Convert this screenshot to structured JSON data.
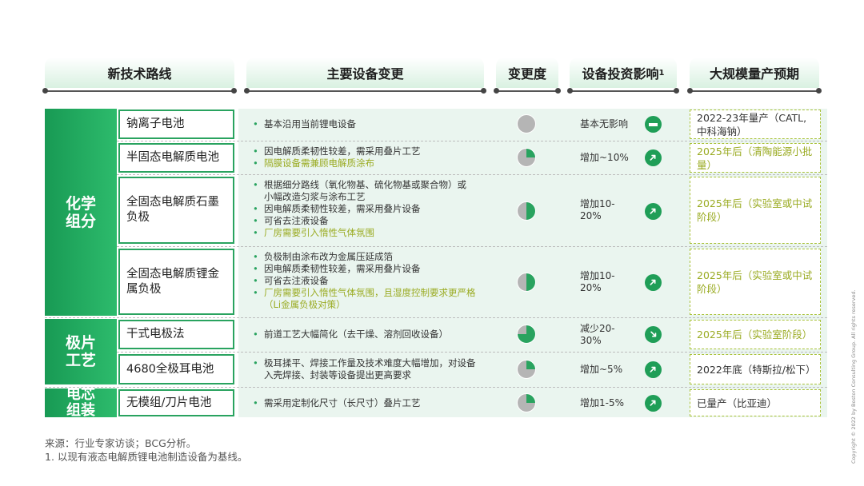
{
  "headers": {
    "route": "新技术路线",
    "equipment": "主要设备变更",
    "degree": "变更度",
    "investment": "设备投资影响",
    "investment_sup": "1",
    "production": "大规模量产预期"
  },
  "categories": {
    "chem_line1": "化学",
    "chem_line2": "组分",
    "pole_line1": "极片",
    "pole_line2": "工艺",
    "pack_line1": "电芯",
    "pack_line2": "组装"
  },
  "rows": [
    {
      "name": "钠离子电池",
      "equipment": [
        {
          "text": "基本沿用当前锂电设备",
          "highlight": false
        }
      ],
      "degree": 0,
      "impact": "基本无影响",
      "impact_icon": "flat-icon",
      "production": "2022-23年量产（CATL,中科海钠）",
      "production_highlight": false
    },
    {
      "name": "半固态电解质电池",
      "equipment": [
        {
          "text": "因电解质柔韧性较差，需采用叠片工艺",
          "highlight": false
        },
        {
          "text": "隔膜设备需兼顾电解质涂布",
          "highlight": true
        }
      ],
      "degree": 0.25,
      "impact": "增加~10%",
      "impact_icon": "arrow-up-right-icon",
      "production": "2025年后（清陶能源小批量）",
      "production_highlight": true
    },
    {
      "name": "全固态电解质石墨负极",
      "equipment": [
        {
          "text": "根据细分路线（氧化物基、硫化物基或聚合物）或小幅改造匀浆与涂布工艺",
          "highlight": false
        },
        {
          "text": "因电解质柔韧性较差，需采用叠片设备",
          "highlight": false
        },
        {
          "text": "可省去注液设备",
          "highlight": false
        },
        {
          "text": "厂房需要引入惰性气体氛围",
          "highlight": true
        }
      ],
      "degree": 0.5,
      "impact": "增加10-20%",
      "impact_icon": "arrow-up-right-icon",
      "production": "2025年后（实验室或中试阶段）",
      "production_highlight": true
    },
    {
      "name": "全固态电解质锂金属负极",
      "equipment": [
        {
          "text": "负极制由涂布改为金属压延成箔",
          "highlight": false
        },
        {
          "text": "因电解质柔韧性较差，需采用叠片设备",
          "highlight": false
        },
        {
          "text": "可省去注液设备",
          "highlight": false
        },
        {
          "text": "厂房需要引入惰性气体氛围，且湿度控制要求更严格（Li金属负极对策）",
          "highlight": true
        }
      ],
      "degree": 0.5,
      "impact": "增加10-20%",
      "impact_icon": "arrow-up-right-icon",
      "production": "2025年后（实验室或中试阶段）",
      "production_highlight": true
    },
    {
      "name": "干式电极法",
      "equipment": [
        {
          "text": "前道工艺大幅简化（去干燥、溶剂回收设备）",
          "highlight": false
        }
      ],
      "degree": 0.75,
      "impact": "减少20-30%",
      "impact_icon": "arrow-down-right-icon",
      "production": "2025年后（实验室阶段）",
      "production_highlight": true
    },
    {
      "name": "4680全极耳电池",
      "equipment": [
        {
          "text": "极耳揉平、焊接工作量及技术难度大幅增加，对设备入壳焊接、封装等设备提出更高要求",
          "highlight": false
        }
      ],
      "degree": 0.25,
      "impact": "增加~5%",
      "impact_icon": "arrow-up-right-icon",
      "production": "2022年底（特斯拉/松下）",
      "production_highlight": false
    },
    {
      "name": "无模组/刀片电池",
      "equipment": [
        {
          "text": "需采用定制化尺寸（长尺寸）叠片工艺",
          "highlight": false
        }
      ],
      "degree": 0.25,
      "impact": "增加1-5%",
      "impact_icon": "arrow-up-right-icon",
      "production": "已量产（比亚迪）",
      "production_highlight": false
    }
  ],
  "footer": {
    "source": "来源：行业专家访谈；BCG分析。",
    "note": "1. 以现有液态电解质锂电池制造设备为基线。"
  },
  "copyright": "Copyright © 2022 by Boston Consulting Group. All rights reserved.",
  "colors": {
    "accent": "#29a35f",
    "highlight": "#9aab22",
    "gray": "#b5b5b5"
  }
}
